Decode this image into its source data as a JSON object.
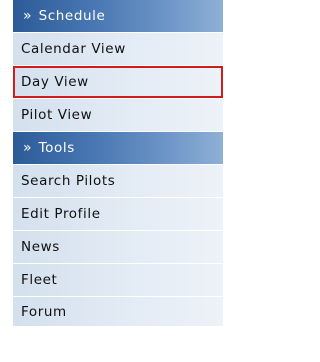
{
  "menu": {
    "schedule_header": {
      "marker": "»",
      "label": "Schedule"
    },
    "calendar_view": "Calendar View",
    "day_view": "Day View",
    "pilot_view": "Pilot View",
    "tools_header": {
      "marker": "»",
      "label": "Tools"
    },
    "search_pilots": "Search Pilots",
    "edit_profile": "Edit Profile",
    "news": "News",
    "fleet": "Fleet",
    "forum": "Forum"
  },
  "colors": {
    "header_gradient_start": "#2d5b98",
    "header_gradient_end": "#8fb0d6",
    "item_background": "#e3ebf5",
    "selected_outline": "#d21b1b"
  },
  "selected_item": "Day View"
}
